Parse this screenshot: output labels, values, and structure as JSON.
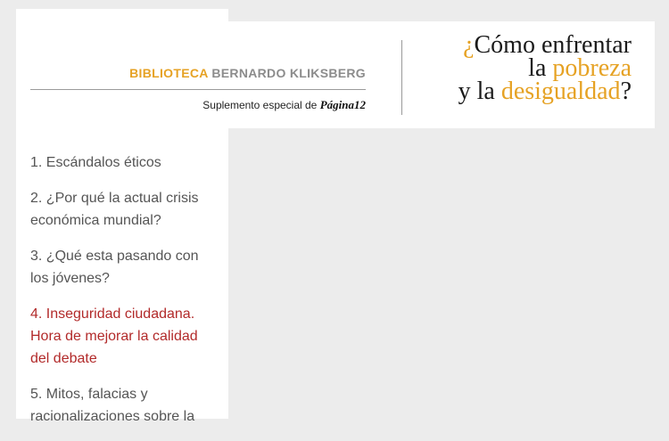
{
  "header": {
    "library_part1": "BIBLIOTECA",
    "library_part2": "BERNARDO KLIKSBERG",
    "supplement_text": "Suplemento especial de",
    "supplement_brand": "Página12",
    "title": {
      "q_open": "¿",
      "line1": "Cómo enfrentar",
      "line2_prefix": "la ",
      "line2_highlight": "pobreza",
      "line3_prefix": "y la ",
      "line3_highlight": "desigualdad",
      "q_close": "?"
    }
  },
  "colors": {
    "accent": "#e6a224",
    "active_link": "#b22a2a",
    "link": "#555555",
    "background": "#ececec"
  },
  "nav": {
    "items": [
      {
        "label": "1. Escándalos éticos"
      },
      {
        "label": "2. ¿Por qué la actual crisis económica mundial?"
      },
      {
        "label": "3. ¿Qué esta pasando con los jóvenes?"
      },
      {
        "label": "4. Inseguridad ciudadana. Hora de mejorar la calidad del debate",
        "active": true
      },
      {
        "label": "5. Mitos, falacias y racionalizaciones sobre la"
      }
    ]
  }
}
